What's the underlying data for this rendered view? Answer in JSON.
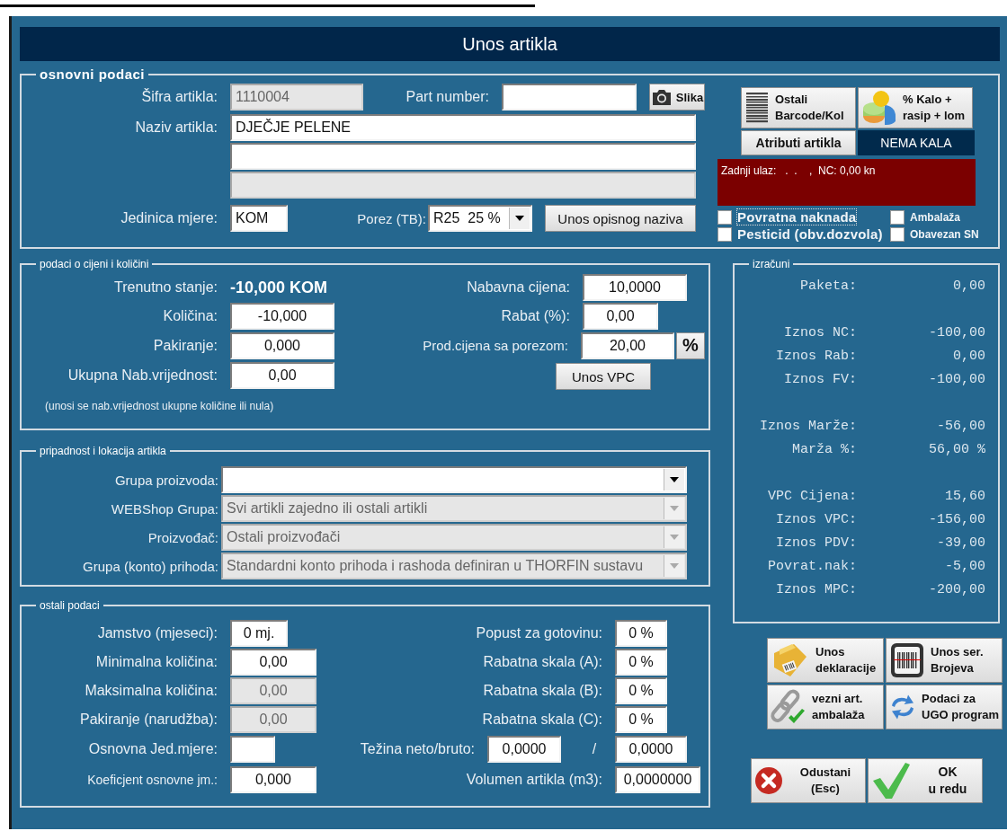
{
  "window": {
    "title": "Unos artikla"
  },
  "basic": {
    "legend": "osnovni podaci",
    "code": {
      "label": "Šifra artikla:",
      "value": "1110004",
      "disabled": true
    },
    "part_number": {
      "label": "Part number:",
      "disabled": false
    },
    "photo_button": "Slika",
    "name": {
      "label": "Naziv artikla:",
      "lines": [
        {
          "value": "DJEČJE PELENE",
          "disabled": false
        },
        {
          "disabled": false
        },
        {
          "disabled": true
        }
      ]
    },
    "unit": {
      "label": "Jedinica mjere:",
      "value": "KOM"
    },
    "tax": {
      "label": "Porez (TB):",
      "value": "R25  25 %"
    },
    "description_button": "Unos opisnog naziva",
    "tool_buttons": [
      {
        "kind": "barcode",
        "lines": [
          "Ostali",
          "Barcode/Kol"
        ]
      },
      {
        "kind": "shrinkage",
        "lines": [
          "% Kalo +",
          "rasip + lom"
        ]
      }
    ],
    "attributes_button": "Atributi artikla",
    "shrinkage_status": "NEMA KALA",
    "last_entry": "Zadnji ulaz:   .  .    ,  NC: 0,00 kn",
    "checkboxes": [
      {
        "label": "Povratna naknada",
        "checked": false,
        "focused": true,
        "kind": "large"
      },
      {
        "label": "Ambalaža",
        "checked": false,
        "focused": false,
        "kind": "small"
      },
      {
        "label": "Pesticid (obv.dozvola)",
        "checked": false,
        "focused": false,
        "kind": "large"
      },
      {
        "label": "Obavezan SN",
        "checked": false,
        "focused": false,
        "kind": "small"
      }
    ]
  },
  "prices": {
    "legend": "podaci o cijeni i količini",
    "left": [
      {
        "kind": "text",
        "label": "Trenutno stanje:",
        "value": "-10,000 KOM"
      },
      {
        "kind": "field",
        "label": "Količina:",
        "value": "-10,000"
      },
      {
        "kind": "field",
        "label": "Pakiranje:",
        "value": "0,000"
      },
      {
        "kind": "field",
        "label": "Ukupna Nab.vrijednost:",
        "value": "0,00"
      }
    ],
    "note": "(unosi se nab.vrijednost ukupne količine ili nula)",
    "right": [
      {
        "label": "Nabavna cijena:",
        "value": "10,0000"
      },
      {
        "label": "Rabat (%):",
        "value": "0,00"
      },
      {
        "label": "Prod.cijena sa porezom:",
        "value": "20,00"
      }
    ],
    "percent_button": "%",
    "vpc_button": "Unos VPC"
  },
  "membership": {
    "legend": "pripadnost i lokacija artikla",
    "selects": [
      {
        "label": "Grupa proizvoda:",
        "disabled": false
      },
      {
        "label": "WEBShop Grupa:",
        "value": "Svi artikli zajedno ili ostali artikli",
        "disabled": true
      },
      {
        "label": "Proizvođač:",
        "value": "Ostali proizvođači",
        "disabled": true
      },
      {
        "label": "Grupa (konto) prihoda:",
        "value": "Standardni konto prihoda i rashoda definiran u THORFIN sustavu",
        "disabled": true
      }
    ]
  },
  "other": {
    "legend": "ostali podaci",
    "left": [
      {
        "label": "Jamstvo (mjeseci):",
        "value": "0 mj.",
        "kind": "short",
        "disabled": false
      },
      {
        "label": "Minimalna količina:",
        "value": "0,00",
        "kind": "normal",
        "disabled": false
      },
      {
        "label": "Maksimalna količina:",
        "value": "0,00",
        "kind": "normal",
        "disabled": true
      },
      {
        "label": "Pakiranje (narudžba):",
        "value": "0,00",
        "kind": "normal",
        "disabled": true
      },
      {
        "label": "Osnovna Jed.mjere:",
        "kind": "tiny",
        "disabled": false
      },
      {
        "label": "Koeficjent osnovne jm.:",
        "value": "0,000",
        "kind": "normal",
        "disabled": false
      }
    ],
    "right": [
      {
        "kind": "field",
        "label": "Popust za gotovinu:",
        "value": "0 %"
      },
      {
        "kind": "field",
        "label": "Rabatna skala (A):",
        "value": "0 %"
      },
      {
        "kind": "field",
        "label": "Rabatna skala (B):",
        "value": "0 %"
      },
      {
        "kind": "field",
        "label": "Rabatna skala (C):",
        "value": "0 %"
      },
      {
        "kind": "pair",
        "label": "Težina neto/bruto:",
        "value": "0,0000",
        "separator": "/",
        "second_value": "0,0000"
      },
      {
        "kind": "wide",
        "label": "Volumen artikla (m3):",
        "value": "0,0000000"
      }
    ]
  },
  "calculations": {
    "legend": "izračuni",
    "groups": [
      {
        "rows": [
          {
            "label": "Paketa:",
            "value": "0,00"
          }
        ]
      },
      {
        "rows": [
          {
            "label": "Iznos NC:",
            "value": "-100,00"
          },
          {
            "label": "Iznos Rab:",
            "value": "0,00"
          },
          {
            "label": "Iznos FV:",
            "value": "-100,00"
          }
        ]
      },
      {
        "rows": [
          {
            "label": "Iznos Marže:",
            "value": "-56,00"
          },
          {
            "label": "Marža %:",
            "value": "56,00 %"
          }
        ]
      },
      {
        "rows": [
          {
            "label": "VPC Cijena:",
            "value": "15,60"
          },
          {
            "label": "Iznos VPC:",
            "value": "-156,00"
          },
          {
            "label": "Iznos PDV:",
            "value": "-39,00"
          },
          {
            "label": "Povrat.nak:",
            "value": "-5,00"
          },
          {
            "label": "Iznos MPC:",
            "value": "-200,00"
          }
        ]
      }
    ]
  },
  "actions": [
    {
      "kind": "declaration",
      "lines": [
        "Unos",
        "deklaracije"
      ]
    },
    {
      "kind": "serial",
      "lines": [
        "Unos ser.",
        "Brojeva"
      ]
    },
    {
      "kind": "linked",
      "lines": [
        "vezni art.",
        "ambalaža"
      ]
    },
    {
      "kind": "sync",
      "lines": [
        "Podaci za",
        "UGO program"
      ]
    }
  ],
  "dialog_buttons": [
    {
      "kind": "cancel",
      "lines": [
        "Odustani",
        "(Esc)"
      ]
    },
    {
      "kind": "ok",
      "lines": [
        "OK",
        "u redu"
      ]
    }
  ]
}
